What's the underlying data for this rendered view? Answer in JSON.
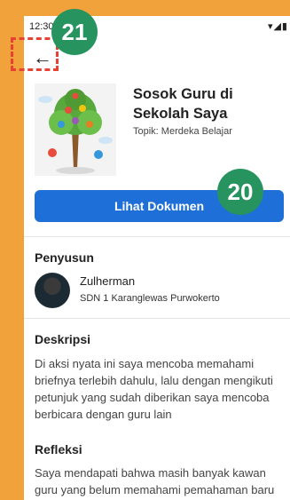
{
  "status_bar": {
    "time": "12:30",
    "icons": "wifi signal battery"
  },
  "header": {
    "back_icon": "arrow-left-icon"
  },
  "doc": {
    "title": "Sosok Guru di Sekolah Saya",
    "topic": "Topik: Merdeka Belajar",
    "button_label": "Lihat Dokumen"
  },
  "author_section": {
    "heading": "Penyusun",
    "name": "Zulherman",
    "school": "SDN 1 Karanglewas Purwokerto"
  },
  "description": {
    "heading": "Deskripsi",
    "text": "Di aksi nyata ini saya mencoba memahami briefnya terlebih dahulu, lalu dengan mengikuti petunjuk yang sudah diberikan saya mencoba berbicara dengan guru lain"
  },
  "reflection": {
    "heading": "Refleksi",
    "text": "Saya mendapati bahwa masih banyak kawan guru yang belum memahami pemahaman baru"
  },
  "annotations": {
    "badge_top": "21",
    "badge_button": "20"
  },
  "colors": {
    "accent": "#1f6fd8",
    "badge": "#27935f",
    "frame": "#F2A23A",
    "dash": "#e64234"
  }
}
